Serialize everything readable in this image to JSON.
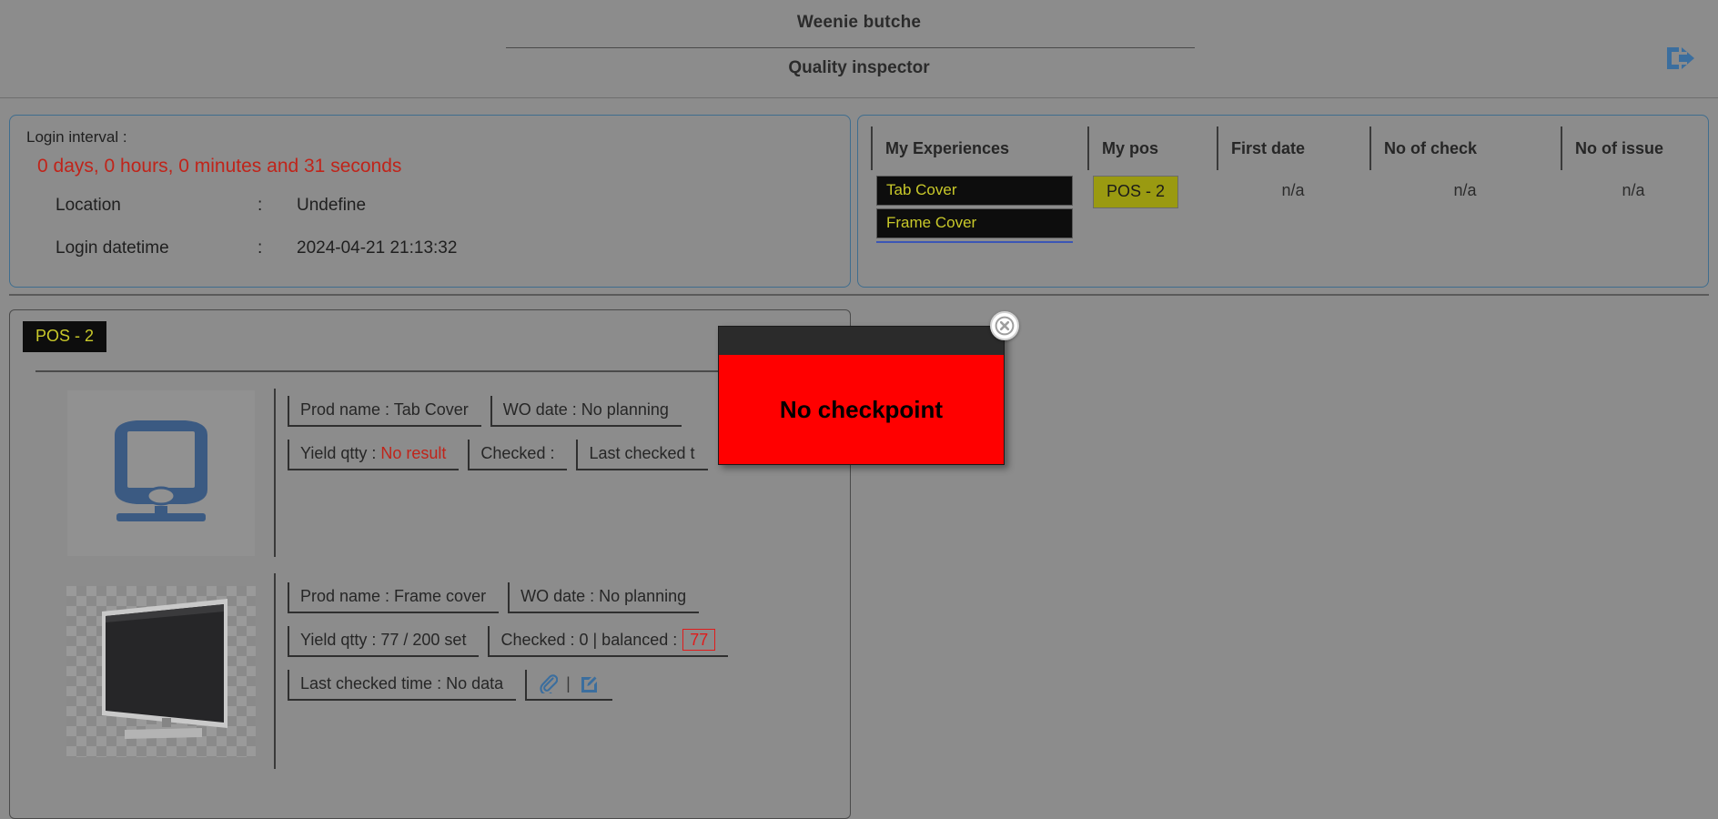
{
  "header": {
    "title": "Weenie butche",
    "subtitle": "Quality inspector",
    "logout_icon": "logout-icon"
  },
  "login_panel": {
    "interval_label": "Login interval :",
    "interval_value": "0 days, 0 hours, 0 minutes and 31 seconds",
    "location_label": "Location",
    "location_sep": ":",
    "location_value": "Undefine",
    "datetime_label": "Login datetime",
    "datetime_sep": ":",
    "datetime_value": "2024-04-21 21:13:32",
    "interval_color": "#c0241a"
  },
  "experiences_panel": {
    "columns": [
      "My Experiences",
      "My pos",
      "First date",
      "No of check",
      "No of issue"
    ],
    "experience_chips": [
      "Tab Cover",
      "Frame Cover"
    ],
    "my_pos": "POS - 2",
    "first_date": "n/a",
    "no_of_check": "n/a",
    "no_of_issue": "n/a",
    "chip_bg": "#0d0d0d",
    "chip_fg": "#c9c92a",
    "badge_bg": "#9a9a11"
  },
  "pos_card": {
    "badge": "POS - 2",
    "products": [
      {
        "thumb": "monitor-placeholder-icon",
        "prod_name": "Prod name : Tab Cover",
        "wo_date": "WO date : No planning",
        "yield_label": "Yield qtty :",
        "yield_value": "No result",
        "checked": "Checked :",
        "last_checked": "Last checked t"
      },
      {
        "thumb": "television-photo",
        "prod_name": "Prod name : Frame cover",
        "wo_date": "WO date : No planning",
        "yield_label": "Yield qtty : 77 / 200 set",
        "checked": "Checked : 0   | balanced :",
        "balanced_value": "77",
        "last_checked": "Last checked time : No data",
        "attach_icon": "paperclip-icon",
        "icon_separator": "|",
        "edit_icon": "edit-pencil-icon"
      }
    ]
  },
  "modal": {
    "message": "No checkpoint",
    "close_icon": "close-icon",
    "body_color": "#ff0000",
    "header_color": "#2b2b2b"
  }
}
